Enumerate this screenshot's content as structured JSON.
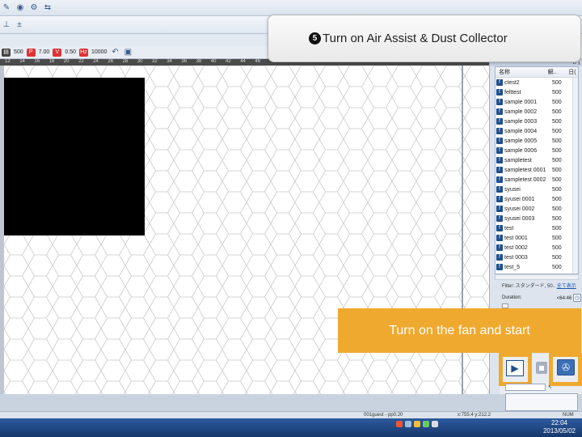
{
  "toolbar_row3": {
    "speed_value": "500",
    "badge_p": "P",
    "power_value": "7.00",
    "badge_v": "V",
    "ppi_value": "0.50",
    "freq_value": "10000"
  },
  "ruler": {
    "ticks": [
      "12",
      "14",
      "16",
      "18",
      "20",
      "22",
      "24",
      "26",
      "28",
      "30",
      "32",
      "34",
      "36",
      "38",
      "40",
      "42",
      "44",
      "46"
    ]
  },
  "right_panel": {
    "header_close": "ㅁ x",
    "list_header": {
      "name": "名称",
      "col2": "解..",
      "col3": "日("
    },
    "items": [
      {
        "name": "ctest2",
        "value": "500"
      },
      {
        "name": "felttest",
        "value": "500"
      },
      {
        "name": "sample 0001",
        "value": "500"
      },
      {
        "name": "sample 0002",
        "value": "500"
      },
      {
        "name": "sample 0003",
        "value": "500"
      },
      {
        "name": "sample 0004",
        "value": "500"
      },
      {
        "name": "sample 0005",
        "value": "500"
      },
      {
        "name": "sample 0006",
        "value": "500"
      },
      {
        "name": "sampletest",
        "value": "500"
      },
      {
        "name": "sampletest 0001",
        "value": "500"
      },
      {
        "name": "sampletest 0002",
        "value": "500"
      },
      {
        "name": "syusei",
        "value": "500"
      },
      {
        "name": "syusei 0001",
        "value": "500"
      },
      {
        "name": "syusei 0002",
        "value": "500"
      },
      {
        "name": "syusei 0003",
        "value": "500"
      },
      {
        "name": "test",
        "value": "500"
      },
      {
        "name": "test 0001",
        "value": "500"
      },
      {
        "name": "test 0002",
        "value": "500"
      },
      {
        "name": "test 0003",
        "value": "500"
      },
      {
        "name": "test_5",
        "value": "500"
      }
    ],
    "filter_label": "Filter: スタンダード, 50..",
    "filter_link": "全て表示",
    "duration_label": "Duration:",
    "duration_value": "<64:46"
  },
  "callouts": {
    "step_number": "5",
    "step_text": "Turn on Air Assist & Dust Collector",
    "fan_text": "Turn on the fan and start"
  },
  "status_bar": {
    "left": "001guest - pp0.20",
    "coords": "x:755.4  y:212.2",
    "num": "NUM"
  },
  "taskbar": {
    "time": "22:04",
    "date": "2013/05/02"
  }
}
